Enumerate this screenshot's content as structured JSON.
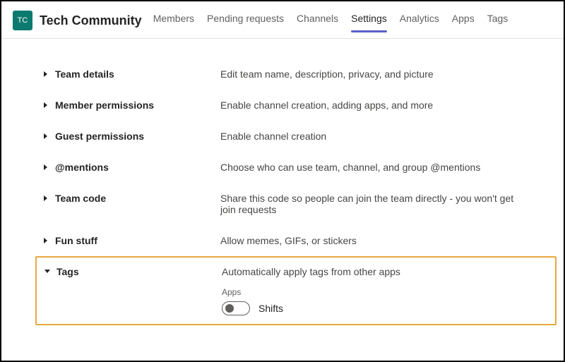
{
  "header": {
    "avatar_initials": "TC",
    "team_name": "Tech Community",
    "tabs": [
      {
        "label": "Members",
        "active": false
      },
      {
        "label": "Pending requests",
        "active": false
      },
      {
        "label": "Channels",
        "active": false
      },
      {
        "label": "Settings",
        "active": true
      },
      {
        "label": "Analytics",
        "active": false
      },
      {
        "label": "Apps",
        "active": false
      },
      {
        "label": "Tags",
        "active": false
      }
    ]
  },
  "settings": [
    {
      "title": "Team details",
      "desc": "Edit team name, description, privacy, and picture",
      "expanded": false
    },
    {
      "title": "Member permissions",
      "desc": "Enable channel creation, adding apps, and more",
      "expanded": false
    },
    {
      "title": "Guest permissions",
      "desc": "Enable channel creation",
      "expanded": false
    },
    {
      "title": "@mentions",
      "desc": "Choose who can use team, channel, and group @mentions",
      "expanded": false
    },
    {
      "title": "Team code",
      "desc": "Share this code so people can join the team directly - you won't get join requests",
      "expanded": false
    },
    {
      "title": "Fun stuff",
      "desc": "Allow memes, GIFs, or stickers",
      "expanded": false
    }
  ],
  "tags_section": {
    "title": "Tags",
    "desc": "Automatically apply tags from other apps",
    "apps_label": "Apps",
    "toggle": {
      "label": "Shifts",
      "on": false
    }
  }
}
